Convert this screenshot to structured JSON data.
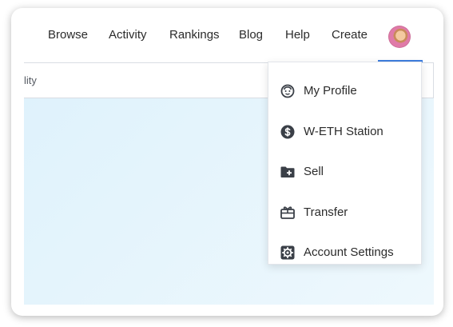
{
  "nav": {
    "links": [
      "Browse",
      "Activity",
      "Rankings",
      "Blog",
      "Help",
      "Create"
    ]
  },
  "filter": {
    "partial_label": "lity"
  },
  "account_menu": {
    "items": [
      {
        "label": "My Profile",
        "icon": "smiley-face-icon"
      },
      {
        "label": "W-ETH Station",
        "icon": "dollar-coin-icon"
      },
      {
        "label": "Sell",
        "icon": "folder-plus-icon"
      },
      {
        "label": "Transfer",
        "icon": "gift-card-icon"
      },
      {
        "label": "Account Settings",
        "icon": "gear-icon"
      }
    ]
  },
  "colors": {
    "accent": "#3f7fe0",
    "panel_background": "#e6f5fc",
    "text": "#2b2b2b",
    "icon": "#3a3f47"
  }
}
